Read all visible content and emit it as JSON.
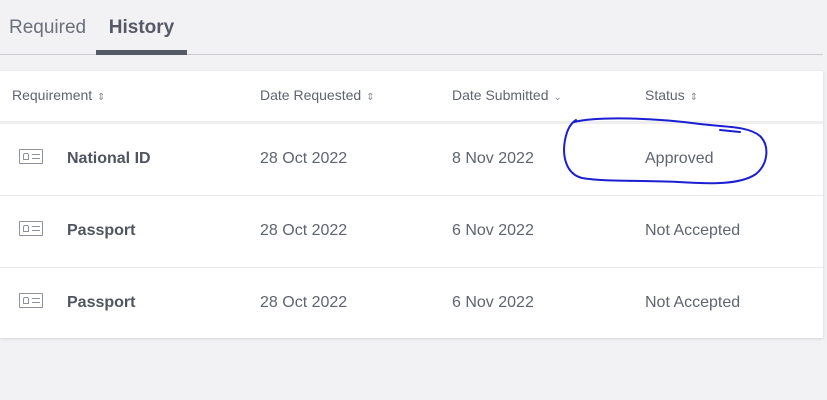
{
  "tabs": {
    "required": "Required",
    "history": "History"
  },
  "table": {
    "headers": {
      "requirement": "Requirement",
      "date_requested": "Date Requested",
      "date_submitted": "Date Submitted",
      "status": "Status"
    },
    "rows": [
      {
        "icon": "id-card-icon",
        "requirement": "National ID",
        "date_requested": "28 Oct 2022",
        "date_submitted": "8 Nov 2022",
        "status": "Approved"
      },
      {
        "icon": "id-card-icon",
        "requirement": "Passport",
        "date_requested": "28 Oct 2022",
        "date_submitted": "6 Nov 2022",
        "status": "Not Accepted"
      },
      {
        "icon": "id-card-icon",
        "requirement": "Passport",
        "date_requested": "28 Oct 2022",
        "date_submitted": "6 Nov 2022",
        "status": "Not Accepted"
      }
    ]
  },
  "colors": {
    "background": "#f2f2f4",
    "text": "#5f6470",
    "annotation": "#1b1fd0"
  }
}
